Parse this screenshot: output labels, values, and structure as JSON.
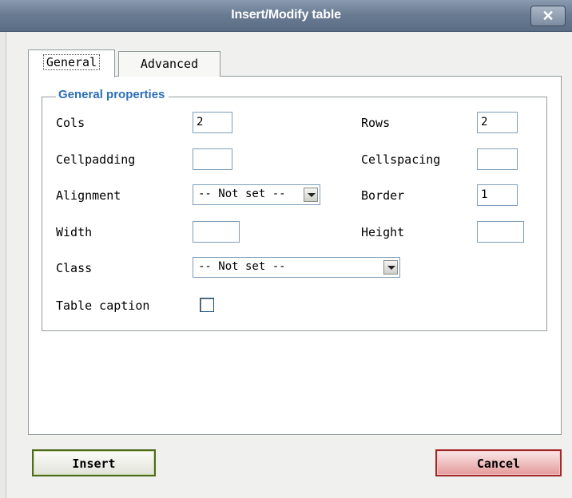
{
  "dialog": {
    "title": "Insert/Modify table",
    "close_label": "✕"
  },
  "tabs": [
    {
      "label": "General",
      "active": true
    },
    {
      "label": "Advanced",
      "active": false
    }
  ],
  "general": {
    "legend": "General properties",
    "cols_label": "Cols",
    "cols_value": "2",
    "rows_label": "Rows",
    "rows_value": "2",
    "cellpadding_label": "Cellpadding",
    "cellpadding_value": "",
    "cellspacing_label": "Cellspacing",
    "cellspacing_value": "",
    "alignment_label": "Alignment",
    "alignment_value": "-- Not set --",
    "border_label": "Border",
    "border_value": "1",
    "width_label": "Width",
    "width_value": "",
    "height_label": "Height",
    "height_value": "",
    "class_label": "Class",
    "class_value": "-- Not set --",
    "caption_label": "Table caption",
    "caption_checked": false
  },
  "buttons": {
    "insert_label": "Insert",
    "cancel_label": "Cancel"
  },
  "colors": {
    "legend": "#2b6fb6",
    "insert_border": "#4f6b1e",
    "cancel_border": "#a02a2a",
    "titlebar": "#6a7c93"
  }
}
